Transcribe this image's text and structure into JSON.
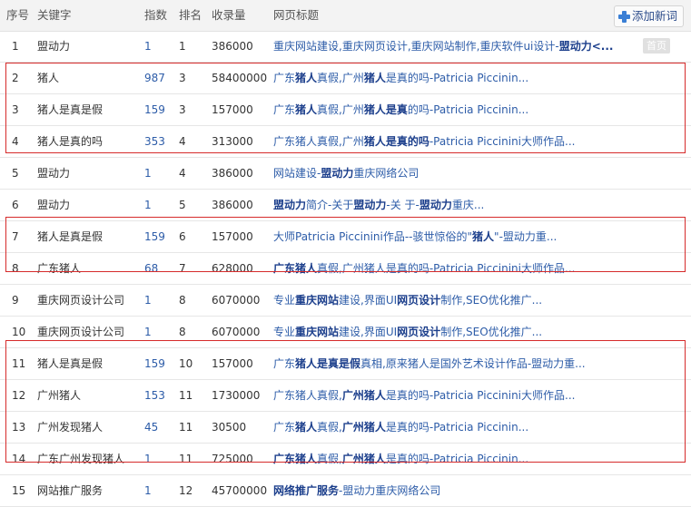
{
  "header": {
    "col_idx": "序号",
    "col_keyword": "关键字",
    "col_index": "指数",
    "col_rank": "排名",
    "col_count": "收录量",
    "col_title": "网页标题",
    "add_button": "添加新词"
  },
  "rows": [
    {
      "idx": "1",
      "keyword": "盟动力",
      "index": "1",
      "rank": "1",
      "count": "386000",
      "title": [
        {
          "t": "重庆网站建设,重庆网页设计,重庆网站制作,重庆软件ui设计-"
        },
        {
          "t": "盟动力<...",
          "b": true
        }
      ],
      "tag": "首页"
    },
    {
      "idx": "2",
      "keyword": "猪人",
      "index": "987",
      "rank": "3",
      "count": "58400000",
      "title": [
        {
          "t": "广东"
        },
        {
          "t": "猪人",
          "b": true
        },
        {
          "t": "真假,广州"
        },
        {
          "t": "猪人",
          "b": true
        },
        {
          "t": "是真的吗-Patricia Piccinin..."
        }
      ]
    },
    {
      "idx": "3",
      "keyword": "猪人是真是假",
      "index": "159",
      "rank": "3",
      "count": "157000",
      "title": [
        {
          "t": "广东"
        },
        {
          "t": "猪人",
          "b": true
        },
        {
          "t": "真假,广州"
        },
        {
          "t": "猪人是真",
          "b": true
        },
        {
          "t": "的吗-Patricia Piccinin..."
        }
      ]
    },
    {
      "idx": "4",
      "keyword": "猪人是真的吗",
      "index": "353",
      "rank": "4",
      "count": "313000",
      "title": [
        {
          "t": "广东猪人真假,广州"
        },
        {
          "t": "猪人是真的吗",
          "b": true
        },
        {
          "t": "-Patricia Piccinini大师作品..."
        }
      ]
    },
    {
      "idx": "5",
      "keyword": "盟动力",
      "index": "1",
      "rank": "4",
      "count": "386000",
      "title": [
        {
          "t": "网站建设-"
        },
        {
          "t": "盟动力",
          "b": true
        },
        {
          "t": "重庆网络公司"
        }
      ]
    },
    {
      "idx": "6",
      "keyword": "盟动力",
      "index": "1",
      "rank": "5",
      "count": "386000",
      "title": [
        {
          "t": "盟动力",
          "b": true
        },
        {
          "t": "简介-关于"
        },
        {
          "t": "盟动力",
          "b": true
        },
        {
          "t": "-关 于-"
        },
        {
          "t": "盟动力",
          "b": true
        },
        {
          "t": "重庆..."
        }
      ]
    },
    {
      "idx": "7",
      "keyword": "猪人是真是假",
      "index": "159",
      "rank": "6",
      "count": "157000",
      "title": [
        {
          "t": "大师Patricia Piccinini作品--骇世惊俗的\""
        },
        {
          "t": "猪人",
          "b": true
        },
        {
          "t": "\"-盟动力重..."
        }
      ]
    },
    {
      "idx": "8",
      "keyword": "广东猪人",
      "index": "68",
      "rank": "7",
      "count": "628000",
      "title": [
        {
          "t": "广东猪人",
          "b": true
        },
        {
          "t": "真假,广州猪人是真的吗-Patricia Piccinini大师作品..."
        }
      ]
    },
    {
      "idx": "9",
      "keyword": "重庆网页设计公司",
      "index": "1",
      "rank": "8",
      "count": "6070000",
      "title": [
        {
          "t": "专业"
        },
        {
          "t": "重庆网站",
          "b": true
        },
        {
          "t": "建设,界面UI"
        },
        {
          "t": "网页设计",
          "b": true
        },
        {
          "t": "制作,SEO优化推广..."
        }
      ]
    },
    {
      "idx": "10",
      "keyword": "重庆网页设计公司",
      "index": "1",
      "rank": "8",
      "count": "6070000",
      "title": [
        {
          "t": "专业"
        },
        {
          "t": "重庆网站",
          "b": true
        },
        {
          "t": "建设,界面UI"
        },
        {
          "t": "网页设计",
          "b": true
        },
        {
          "t": "制作,SEO优化推广..."
        }
      ]
    },
    {
      "idx": "11",
      "keyword": "猪人是真是假",
      "index": "159",
      "rank": "10",
      "count": "157000",
      "title": [
        {
          "t": "广东"
        },
        {
          "t": "猪人是真是假",
          "b": true
        },
        {
          "t": "真相,原来猪人是国外艺术设计作品-盟动力重..."
        }
      ]
    },
    {
      "idx": "12",
      "keyword": "广州猪人",
      "index": "153",
      "rank": "11",
      "count": "1730000",
      "title": [
        {
          "t": "广东猪人真假,"
        },
        {
          "t": "广州猪人",
          "b": true
        },
        {
          "t": "是真的吗-Patricia Piccinini大师作品..."
        }
      ]
    },
    {
      "idx": "13",
      "keyword": "广州发现猪人",
      "index": "45",
      "rank": "11",
      "count": "30500",
      "title": [
        {
          "t": "广东"
        },
        {
          "t": "猪人",
          "b": true
        },
        {
          "t": "真假,"
        },
        {
          "t": "广州猪人",
          "b": true
        },
        {
          "t": "是真的吗-Patricia Piccinin..."
        }
      ]
    },
    {
      "idx": "14",
      "keyword": "广东广州发现猪人",
      "index": "1",
      "rank": "11",
      "count": "725000",
      "title": [
        {
          "t": "广东猪人",
          "b": true
        },
        {
          "t": "真假,"
        },
        {
          "t": "广州猪人",
          "b": true
        },
        {
          "t": "是真的吗-Patricia Piccinin..."
        }
      ]
    },
    {
      "idx": "15",
      "keyword": "网站推广服务",
      "index": "1",
      "rank": "12",
      "count": "45700000",
      "title": [
        {
          "t": "网络推广服务",
          "b": true
        },
        {
          "t": "-盟动力重庆网络公司"
        }
      ]
    }
  ],
  "colors": {
    "highlight_border": "#d62b2b",
    "link": "#2d5ca8",
    "header_bg": "#f3f3f3"
  }
}
